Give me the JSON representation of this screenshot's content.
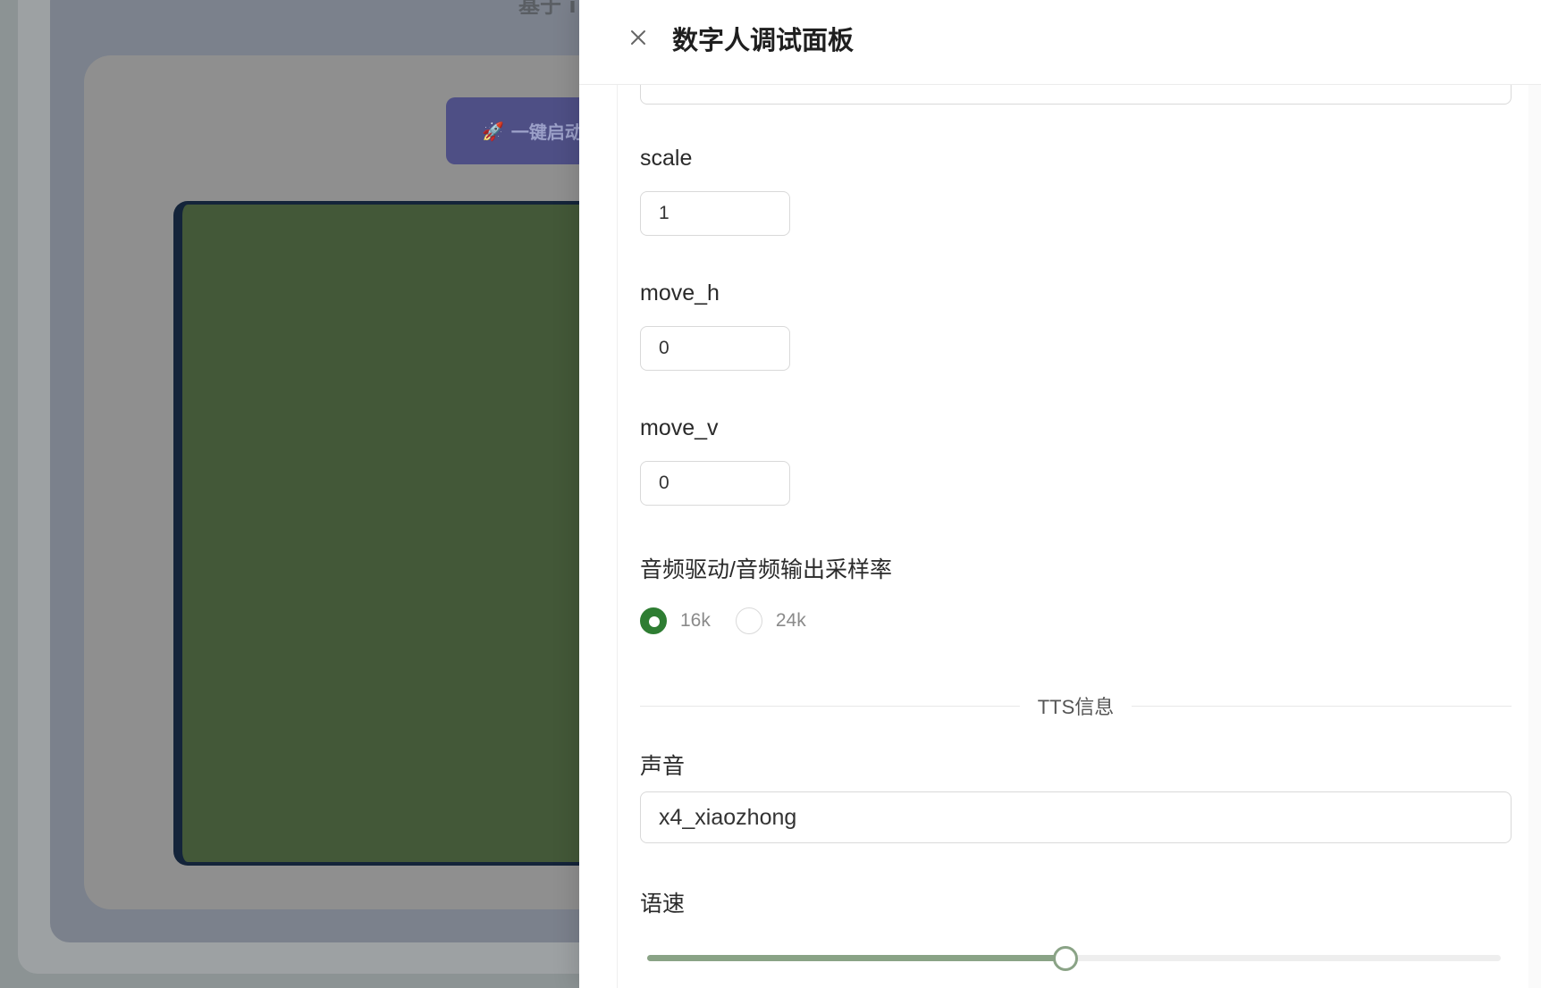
{
  "background": {
    "heading_partial": "基于 i",
    "launch_button_label": "一键启动"
  },
  "drawer": {
    "title": "数字人调试面板",
    "fields": {
      "scale": {
        "label": "scale",
        "value": "1"
      },
      "move_h": {
        "label": "move_h",
        "value": "0"
      },
      "move_v": {
        "label": "move_v",
        "value": "0"
      }
    },
    "sample_rate": {
      "label": "音频驱动/音频输出采样率",
      "options": [
        "16k",
        "24k"
      ],
      "selected": "16k"
    },
    "tts_section": {
      "divider_label": "TTS信息",
      "voice": {
        "label": "声音",
        "value": "x4_xiaozhong"
      },
      "speed": {
        "label": "语速",
        "value_fraction": 0.49
      }
    }
  },
  "colors": {
    "accent": "#2e7d32",
    "slider": "#8aa386"
  }
}
